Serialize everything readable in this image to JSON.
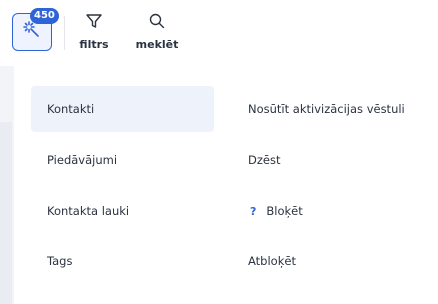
{
  "toolbar": {
    "magic_button": {
      "badge": "450",
      "icon": "magic-wand-icon"
    },
    "filter": {
      "label": "filtrs",
      "icon": "filter-icon"
    },
    "search": {
      "label": "meklēt",
      "icon": "search-icon"
    }
  },
  "menu": {
    "left": [
      {
        "label": "Kontakti",
        "active": true
      },
      {
        "label": "Piedāvājumi"
      },
      {
        "label": "Kontakta lauki"
      },
      {
        "label": "Tags"
      }
    ],
    "right": [
      {
        "label": "Nosūtīt aktivizācijas vēstuli"
      },
      {
        "label": "Dzēst"
      },
      {
        "label": "Bloķēt",
        "icon": "question-mark-icon",
        "icon_text": "?"
      },
      {
        "label": "Atbloķēt"
      }
    ]
  },
  "colors": {
    "accent": "#2f63d8",
    "active_bg": "#eef2fb"
  }
}
